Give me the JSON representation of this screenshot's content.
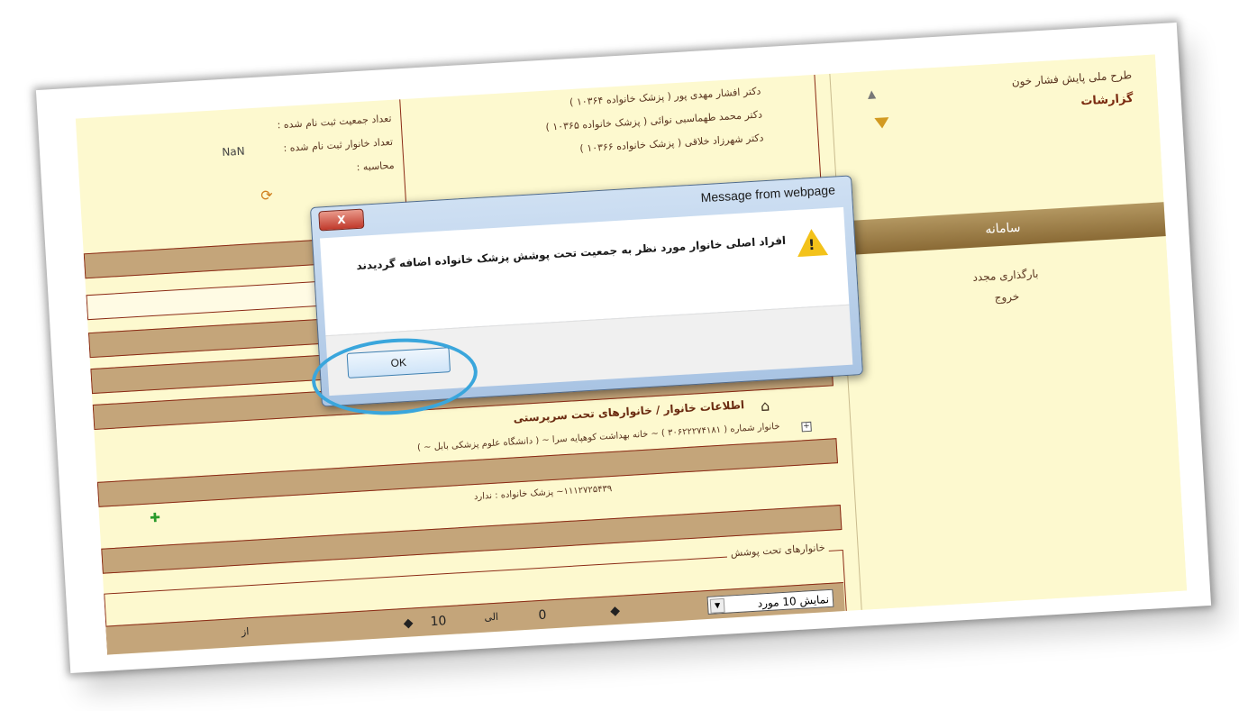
{
  "sidebar": {
    "title": "طرح ملی پایش فشار خون",
    "reports": "گزارشات",
    "system_header": "سامانه",
    "reload": "بارگذاری مجدد",
    "exit": "خروج"
  },
  "doctors": [
    "دکتر افشار مهدی پور ( پزشک خانواده ۱۰۳۶۴ )",
    "دکتر محمد طهماسبی نوائی ( پزشک خانواده ۱۰۳۶۵ )",
    "دکتر شهرزاد خلاقی ( پزشک خانواده ۱۰۳۶۶ )"
  ],
  "stats": {
    "population_label": "تعداد جمعیت ثبت نام شده :",
    "families_label": "تعداد خانوار ثبت نام شده :",
    "calc_label": "محاسبه :",
    "population_value": "NaN"
  },
  "family_info": {
    "title": "اطلاعات خانوار / خانوارهای تحت سرپرستی",
    "family_line": "خانوار شماره ( ۳۰۶۲۲۲۷۴۱۸۱ ) ~ خانه بهداشت کوهپایه سرا ~ ( دانشگاه علوم پزشکی بابل ~ )",
    "detail_line": "۱۱۱۲۷۲۵۴۳۹~ پزشک خانواده : ندارد"
  },
  "families_covered": {
    "legend": "خانوارهای تحت پوشش",
    "page_size": "نمایش 10 مورد",
    "from": "0",
    "to": "10",
    "to_label": "الی",
    "of_label": "از"
  },
  "dialog": {
    "title": "Message from webpage",
    "close": "X",
    "message_line1": "افراد اصلی خانوار مورد نظر به جمعیت تحت پوشش پزشک خانواده اضافه گردیدند",
    "ok": "OK"
  }
}
